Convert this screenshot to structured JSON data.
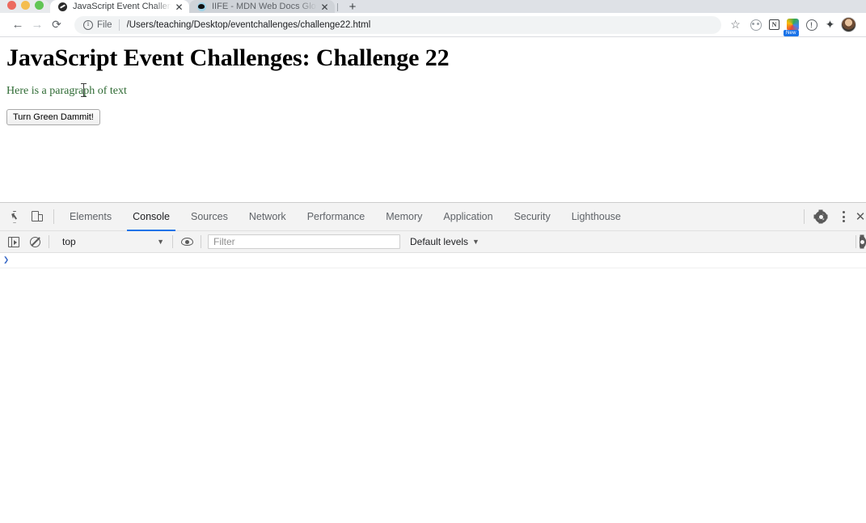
{
  "browser": {
    "window_controls": [
      "close",
      "minimize",
      "zoom"
    ],
    "tabs": [
      {
        "title": "JavaScript Event Challenges: C",
        "favicon": "dark-circle-favicon",
        "active": true,
        "close_label": "✕"
      },
      {
        "title": "IIFE - MDN Web Docs Glossary",
        "favicon": "mdn-favicon",
        "active": false,
        "close_label": "✕"
      }
    ],
    "new_tab_label": "+",
    "nav": {
      "back": "←",
      "forward": "→",
      "reload": "⟳"
    },
    "omnibox": {
      "scheme_label": "File",
      "url": "/Users/teaching/Desktop/eventchallenges/challenge22.html",
      "info_icon": "info-circle-icon"
    },
    "toolbar_icons": [
      {
        "name": "bookmark-star-icon",
        "glyph": "☆"
      },
      {
        "name": "extension-circle-icon",
        "glyph": ""
      },
      {
        "name": "notion-extension-icon",
        "glyph": "N"
      },
      {
        "name": "rainbow-extension-icon",
        "glyph": "",
        "badge": "New"
      },
      {
        "name": "exclamation-circle-icon",
        "glyph": "!"
      },
      {
        "name": "extensions-puzzle-icon",
        "glyph": "✦"
      },
      {
        "name": "profile-avatar",
        "glyph": ""
      }
    ]
  },
  "page": {
    "heading": "JavaScript Event Challenges: Challenge 22",
    "paragraph": "Here is a paragraph of text",
    "paragraph_color": "#2f6b34",
    "button_label": "Turn Green Dammit!"
  },
  "devtools": {
    "left_icons": [
      {
        "name": "inspect-element-icon"
      },
      {
        "name": "device-toolbar-icon"
      }
    ],
    "tabs": [
      {
        "label": "Elements",
        "active": false
      },
      {
        "label": "Console",
        "active": true
      },
      {
        "label": "Sources",
        "active": false
      },
      {
        "label": "Network",
        "active": false
      },
      {
        "label": "Performance",
        "active": false
      },
      {
        "label": "Memory",
        "active": false
      },
      {
        "label": "Application",
        "active": false
      },
      {
        "label": "Security",
        "active": false
      },
      {
        "label": "Lighthouse",
        "active": false
      }
    ],
    "active_tab_accent": "#1a73e8",
    "right_icons": [
      {
        "name": "settings-gear-icon"
      },
      {
        "name": "more-options-kebab-icon"
      },
      {
        "name": "close-devtools-icon",
        "glyph": "✕"
      }
    ],
    "console_toolbar": {
      "sidebar_toggle": "console-sidebar-toggle-icon",
      "clear_console": "clear-console-icon",
      "context_value": "top",
      "context_caret": "▼",
      "live_expression_eye": "eye-icon",
      "filter_placeholder": "Filter",
      "filter_value": "",
      "levels_label": "Default levels",
      "levels_caret": "▼",
      "settings_gear": "console-settings-gear-icon"
    },
    "console_prompt_chevron": "❯",
    "console_messages": []
  }
}
